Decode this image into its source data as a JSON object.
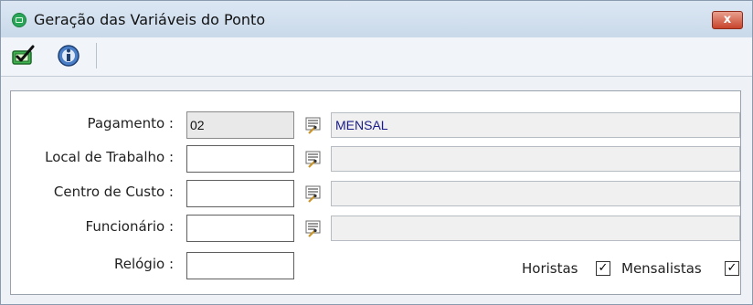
{
  "window": {
    "title": "Geração das Variáveis do Ponto",
    "close_glyph": "x"
  },
  "toolbar": {
    "execute_icon": "execute-check-icon",
    "info_icon": "info-icon"
  },
  "form": {
    "pagamento": {
      "label": "Pagamento :",
      "value": "02",
      "description": "MENSAL"
    },
    "local_trabalho": {
      "label": "Local de Trabalho :",
      "value": "",
      "description": ""
    },
    "centro_custo": {
      "label": "Centro de Custo :",
      "value": "",
      "description": ""
    },
    "funcionario": {
      "label": "Funcionário :",
      "value": "",
      "description": ""
    },
    "relogio": {
      "label": "Relógio :",
      "value": ""
    },
    "horistas": {
      "label": "Horistas",
      "checked": true,
      "mark": "✓"
    },
    "mensalistas": {
      "label": "Mensalistas",
      "checked": true,
      "mark": "✓"
    }
  },
  "colors": {
    "description_text": "#1a1a88",
    "close_button": "#c7432b",
    "title_bar": "#dce7f3"
  }
}
